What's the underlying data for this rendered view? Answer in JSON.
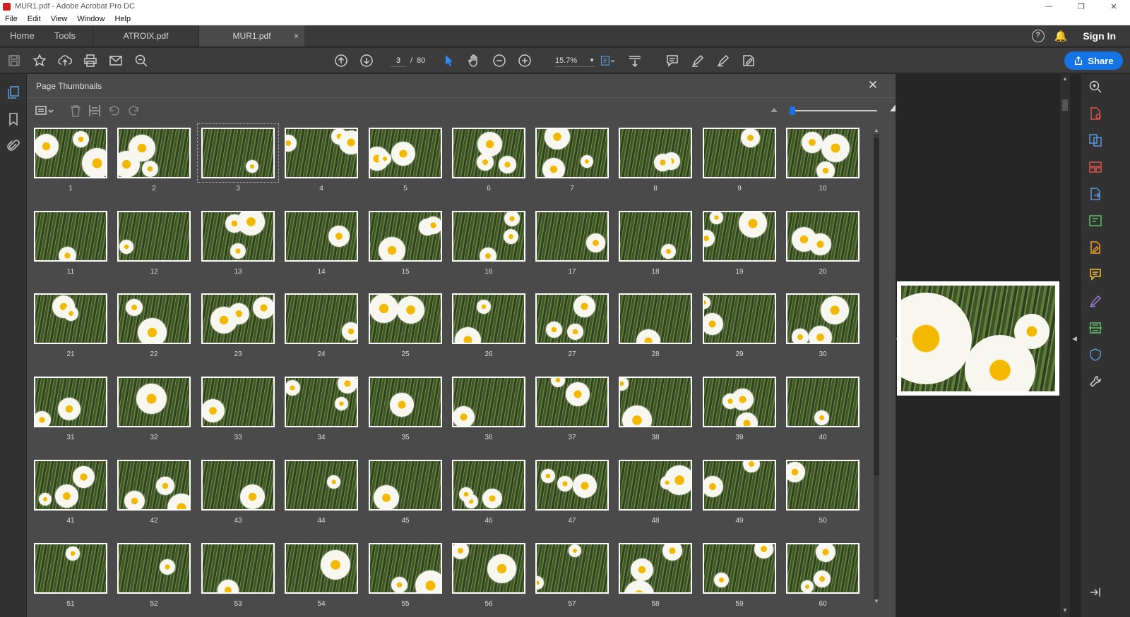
{
  "window": {
    "title": "MUR1.pdf - Adobe Acrobat Pro DC",
    "minimize": "—",
    "restore": "❐",
    "close": "✕"
  },
  "menubar": {
    "items": [
      "File",
      "Edit",
      "View",
      "Window",
      "Help"
    ]
  },
  "tabs": {
    "home": "Home",
    "tools": "Tools",
    "documents": [
      {
        "label": "ATROIX.pdf",
        "active": false
      },
      {
        "label": "MUR1.pdf",
        "active": true
      }
    ],
    "close_glyph": "×",
    "help_glyph": "?",
    "sign_in": "Sign In"
  },
  "toolbar": {
    "current_page": "3",
    "page_separator": "/",
    "total_pages": "80",
    "zoom": "15.7%",
    "share_label": "Share"
  },
  "panel": {
    "title": "Page Thumbnails",
    "close_glyph": "✕",
    "thumbnail_size_fraction": 0.0,
    "selected_page": 3,
    "pages": [
      "1",
      "2",
      "3",
      "4",
      "5",
      "6",
      "7",
      "8",
      "9",
      "10",
      "11",
      "12",
      "13",
      "14",
      "15",
      "16",
      "17",
      "18",
      "19",
      "20",
      "21",
      "22",
      "23",
      "24",
      "25",
      "26",
      "27",
      "28",
      "29",
      "30",
      "31",
      "32",
      "33",
      "34",
      "35",
      "36",
      "37",
      "38",
      "39",
      "40",
      "41",
      "42",
      "43",
      "44",
      "45",
      "46",
      "47",
      "48",
      "49",
      "50",
      "51",
      "52",
      "53",
      "54",
      "55",
      "56",
      "57",
      "58",
      "59",
      "60"
    ]
  },
  "colors": {
    "accent": "#1473e6",
    "panel_bg": "#4a4a4a",
    "tool_blue": "#5b9bd5",
    "tool_red": "#e0504a",
    "tool_green": "#5fbf6a",
    "tool_orange": "#f0a020",
    "tool_yellow": "#f2c230",
    "tool_purple": "#9b7fe0"
  }
}
